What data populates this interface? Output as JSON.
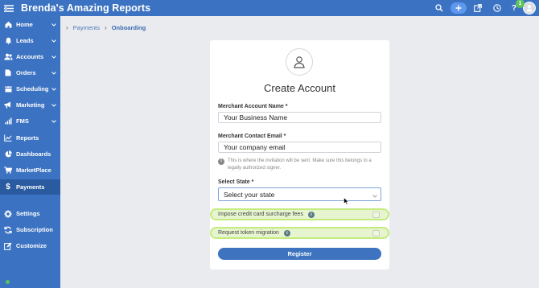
{
  "app": {
    "title": "Brenda's Amazing Reports"
  },
  "topbar": {
    "notification_count": "1"
  },
  "sidebar": {
    "items": [
      {
        "label": "Home",
        "icon": "home-icon",
        "has_chevron": true
      },
      {
        "label": "Leads",
        "icon": "bell-icon",
        "has_chevron": true
      },
      {
        "label": "Accounts",
        "icon": "users-icon",
        "has_chevron": true
      },
      {
        "label": "Orders",
        "icon": "document-icon",
        "has_chevron": true
      },
      {
        "label": "Scheduling",
        "icon": "calendar-icon",
        "has_chevron": true
      },
      {
        "label": "Marketing",
        "icon": "megaphone-icon",
        "has_chevron": true
      },
      {
        "label": "FMS",
        "icon": "signal-icon",
        "has_chevron": true
      },
      {
        "label": "Reports",
        "icon": "line-chart-icon",
        "has_chevron": false
      },
      {
        "label": "Dashboards",
        "icon": "pie-chart-icon",
        "has_chevron": false
      },
      {
        "label": "MarketPlace",
        "icon": "cart-icon",
        "has_chevron": false
      },
      {
        "label": "Payments",
        "icon": "dollar-icon",
        "has_chevron": false,
        "active": true
      },
      {
        "label": "Settings",
        "icon": "gear-icon",
        "has_chevron": false
      },
      {
        "label": "Subscription",
        "icon": "refresh-icon",
        "has_chevron": false
      },
      {
        "label": "Customize",
        "icon": "edit-icon",
        "has_chevron": false
      }
    ]
  },
  "breadcrumb": {
    "parent": "Payments",
    "current": "Onboarding"
  },
  "form": {
    "title": "Create Account",
    "merchant_name_label": "Merchant Account Name *",
    "merchant_name_value": "Your Business Name",
    "merchant_email_label": "Merchant Contact Email *",
    "merchant_email_value": "Your company email",
    "email_hint": "This is where the invitation will be sent. Make sure this belongs to a legally authorized signer.",
    "state_label": "Select State *",
    "state_placeholder": "Select your state",
    "surcharge_label": "Impose credit card surcharge fees",
    "token_migration_label": "Request token migration",
    "register_label": "Register"
  },
  "colors": {
    "brand": "#3b72c2",
    "highlight": "#c4eb7e",
    "status": "#5ec15b"
  }
}
